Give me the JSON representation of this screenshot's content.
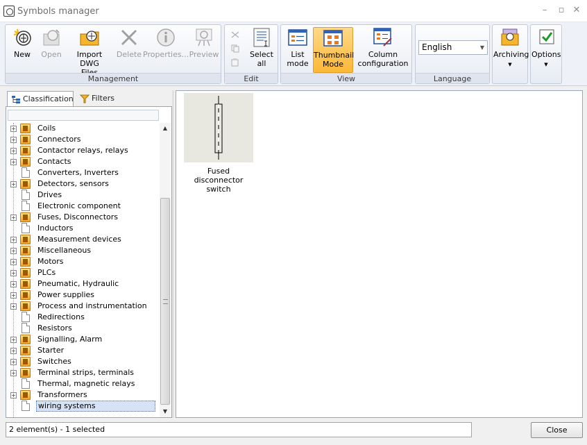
{
  "window": {
    "title": "Symbols manager",
    "minimize": "–",
    "maximize": "▫",
    "close": "✕"
  },
  "ribbon": {
    "groups": {
      "management": "Management",
      "edit": "Edit",
      "view": "View",
      "language": "Language"
    },
    "buttons": {
      "new": "New",
      "open": "Open",
      "import_dwg_1": "Import DWG",
      "import_dwg_2": "Files",
      "delete": "Delete",
      "properties": "Properties...",
      "preview": "Preview",
      "select_all_1": "Select",
      "select_all_2": "all",
      "list_mode_1": "List",
      "list_mode_2": "mode",
      "thumbnail_mode_1": "Thumbnail",
      "thumbnail_mode_2": "Mode",
      "column_config_1": "Column",
      "column_config_2": "configuration",
      "archiving": "Archiving",
      "options": "Options"
    },
    "language_value": "English"
  },
  "left_tabs": {
    "classification": "Classification",
    "filters": "Filters"
  },
  "tree": {
    "items": [
      {
        "label": "Coils",
        "type": "folder"
      },
      {
        "label": "Connectors",
        "type": "folder"
      },
      {
        "label": "Contactor relays, relays",
        "type": "folder"
      },
      {
        "label": "Contacts",
        "type": "folder"
      },
      {
        "label": "Converters, Inverters",
        "type": "doc"
      },
      {
        "label": "Detectors, sensors",
        "type": "folder"
      },
      {
        "label": "Drives",
        "type": "doc"
      },
      {
        "label": "Electronic component",
        "type": "doc"
      },
      {
        "label": "Fuses, Disconnectors",
        "type": "folder"
      },
      {
        "label": "Inductors",
        "type": "doc"
      },
      {
        "label": "Measurement devices",
        "type": "folder"
      },
      {
        "label": "Miscellaneous",
        "type": "folder"
      },
      {
        "label": "Motors",
        "type": "folder"
      },
      {
        "label": "PLCs",
        "type": "folder"
      },
      {
        "label": "Pneumatic, Hydraulic",
        "type": "folder"
      },
      {
        "label": "Power supplies",
        "type": "folder"
      },
      {
        "label": "Process and instrumentation",
        "type": "folder"
      },
      {
        "label": "Redirections",
        "type": "doc"
      },
      {
        "label": "Resistors",
        "type": "doc"
      },
      {
        "label": "Signalling, Alarm",
        "type": "folder"
      },
      {
        "label": "Starter",
        "type": "folder"
      },
      {
        "label": "Switches",
        "type": "folder"
      },
      {
        "label": "Terminal strips, terminals",
        "type": "folder"
      },
      {
        "label": "Thermal, magnetic relays",
        "type": "doc"
      },
      {
        "label": "Transformers",
        "type": "folder"
      },
      {
        "label": "wiring systems",
        "type": "doc",
        "selected": true
      }
    ]
  },
  "thumbnails": [
    {
      "caption_1": "Fused disconnector",
      "caption_2": "switch"
    }
  ],
  "status": {
    "text": "2 element(s) - 1 selected",
    "close_button": "Close"
  }
}
